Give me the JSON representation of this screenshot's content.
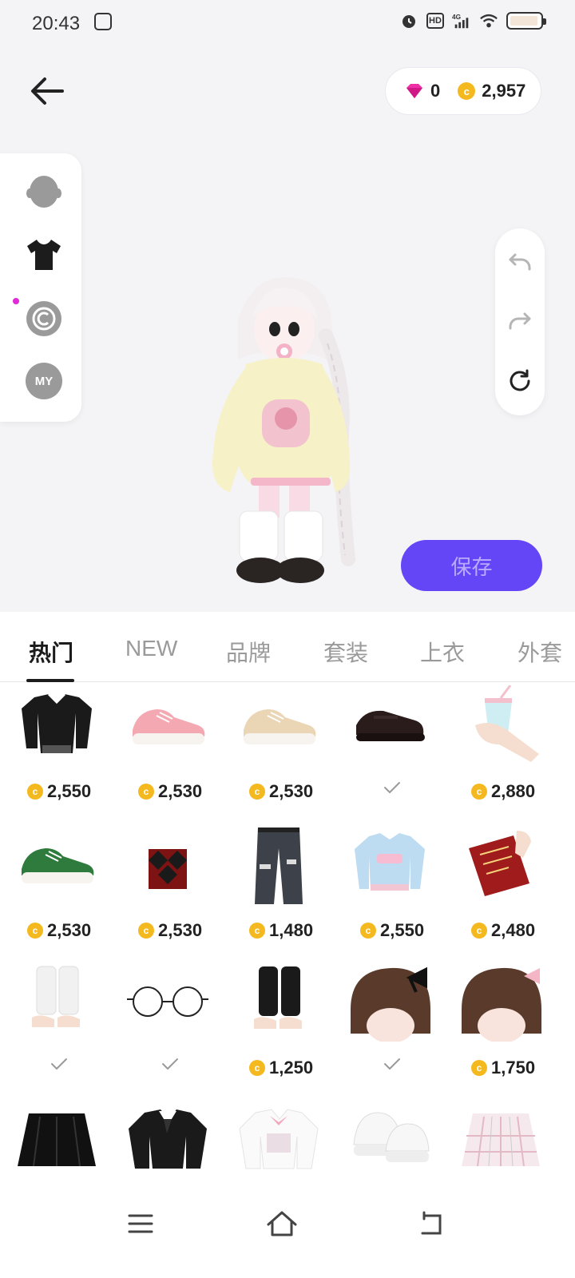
{
  "status": {
    "time": "20:43",
    "hd": "HD",
    "network": "4G"
  },
  "header": {
    "diamonds": "0",
    "coins": "2,957",
    "coin_symbol": "c"
  },
  "side": {
    "my_label": "MY",
    "copyright_symbol": "©"
  },
  "save_label": "保存",
  "tabs": [
    "热门",
    "NEW",
    "品牌",
    "套装",
    "上衣",
    "外套"
  ],
  "items": [
    {
      "name": "black-jacket",
      "price": "2,550",
      "owned": false
    },
    {
      "name": "pink-sneakers",
      "price": "2,530",
      "owned": false
    },
    {
      "name": "beige-sneakers",
      "price": "2,530",
      "owned": false
    },
    {
      "name": "black-mary-janes",
      "price": "",
      "owned": true
    },
    {
      "name": "bubble-tea-hand",
      "price": "2,880",
      "owned": false
    },
    {
      "name": "green-sneakers",
      "price": "2,530",
      "owned": false
    },
    {
      "name": "argyle-vest",
      "price": "2,530",
      "owned": false
    },
    {
      "name": "ripped-jeans",
      "price": "1,480",
      "owned": false
    },
    {
      "name": "blue-sweatshirt",
      "price": "2,550",
      "owned": false
    },
    {
      "name": "red-book-hand",
      "price": "2,480",
      "owned": false
    },
    {
      "name": "white-leg-warmers",
      "price": "",
      "owned": true
    },
    {
      "name": "round-glasses",
      "price": "",
      "owned": true
    },
    {
      "name": "black-leg-warmers",
      "price": "1,250",
      "owned": false
    },
    {
      "name": "black-bow-hair",
      "price": "",
      "owned": true
    },
    {
      "name": "pink-bow-hair",
      "price": "1,750",
      "owned": false
    },
    {
      "name": "black-skirt",
      "price": "",
      "owned": false
    },
    {
      "name": "black-uniform-top",
      "price": "",
      "owned": false
    },
    {
      "name": "white-bow-blouse",
      "price": "",
      "owned": false
    },
    {
      "name": "white-loafers",
      "price": "",
      "owned": false
    },
    {
      "name": "plaid-skirt",
      "price": "",
      "owned": false
    }
  ]
}
